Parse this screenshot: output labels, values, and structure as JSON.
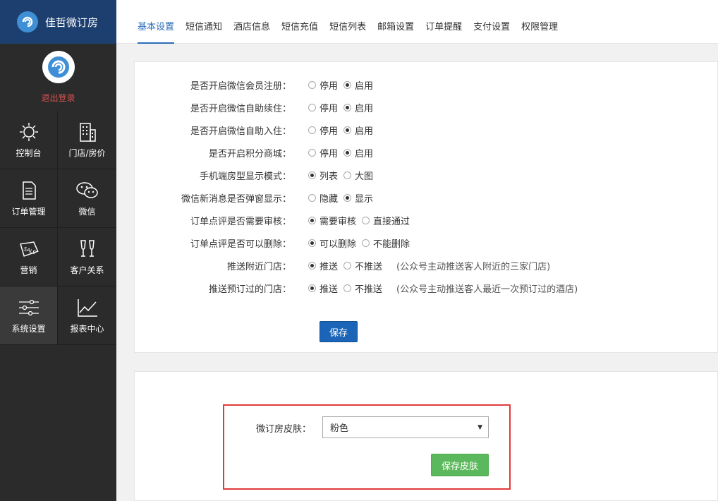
{
  "brand": {
    "name": "佳哲微订房"
  },
  "user": {
    "logout": "退出登录"
  },
  "nav": [
    {
      "label": "控制台",
      "icon": "sun-gear-icon"
    },
    {
      "label": "门店/房价",
      "icon": "building-icon"
    },
    {
      "label": "订单管理",
      "icon": "document-icon"
    },
    {
      "label": "微信",
      "icon": "wechat-icon"
    },
    {
      "label": "营销",
      "icon": "sale-tag-icon"
    },
    {
      "label": "客户关系",
      "icon": "glasses-toast-icon"
    },
    {
      "label": "系统设置",
      "icon": "sliders-icon",
      "active": true
    },
    {
      "label": "报表中心",
      "icon": "line-chart-icon"
    }
  ],
  "tabs": [
    "基本设置",
    "短信通知",
    "酒店信息",
    "短信充值",
    "短信列表",
    "邮箱设置",
    "订单提醒",
    "支付设置",
    "权限管理"
  ],
  "settings": [
    {
      "label": "是否开启微信会员注册：",
      "options": [
        "停用",
        "启用"
      ],
      "selected": 1
    },
    {
      "label": "是否开启微信自助续住：",
      "options": [
        "停用",
        "启用"
      ],
      "selected": 1
    },
    {
      "label": "是否开启微信自助入住：",
      "options": [
        "停用",
        "启用"
      ],
      "selected": 1
    },
    {
      "label": "是否开启积分商城：",
      "options": [
        "停用",
        "启用"
      ],
      "selected": 1
    },
    {
      "label": "手机端房型显示模式：",
      "options": [
        "列表",
        "大图"
      ],
      "selected": 0
    },
    {
      "label": "微信新消息是否弹窗显示：",
      "options": [
        "隐藏",
        "显示"
      ],
      "selected": 1
    },
    {
      "label": "订单点评是否需要审核：",
      "options": [
        "需要审核",
        "直接通过"
      ],
      "selected": 0
    },
    {
      "label": "订单点评是否可以删除：",
      "options": [
        "可以删除",
        "不能删除"
      ],
      "selected": 0
    },
    {
      "label": "推送附近门店：",
      "options": [
        "推送",
        "不推送"
      ],
      "selected": 0,
      "hint": "(公众号主动推送客人附近的三家门店)"
    },
    {
      "label": "推送预订过的门店：",
      "options": [
        "推送",
        "不推送"
      ],
      "selected": 0,
      "hint": "(公众号主动推送客人最近一次预订过的酒店)"
    }
  ],
  "save_label": "保存",
  "skin": {
    "label": "微订房皮肤：",
    "value": "粉色",
    "button": "保存皮肤"
  }
}
